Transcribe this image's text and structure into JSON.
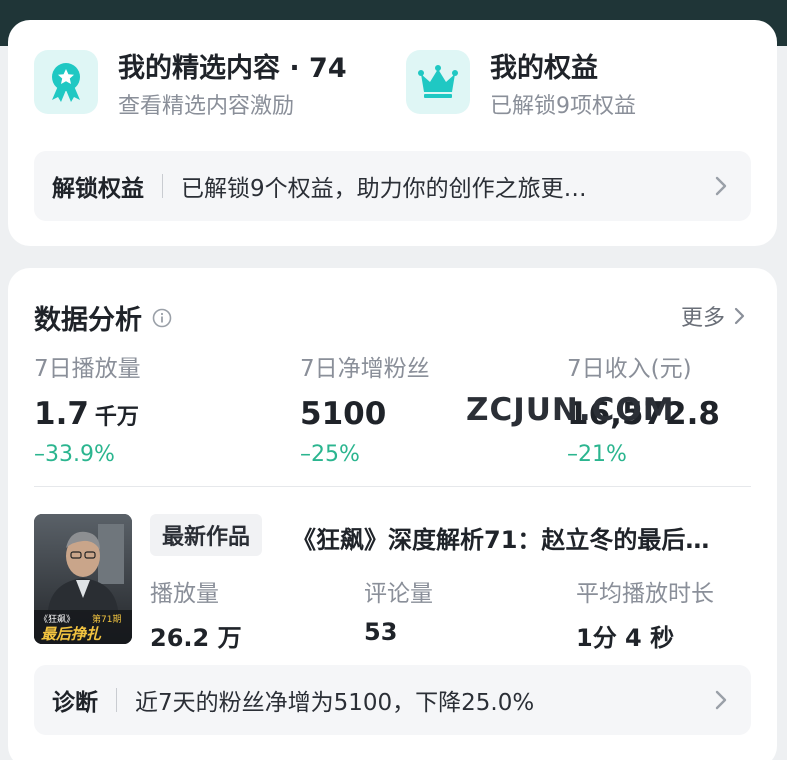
{
  "benefits_card": {
    "featured": {
      "title": "我的精选内容 · 74",
      "subtitle": "查看精选内容激励",
      "icon": "award-ribbon-icon"
    },
    "rights": {
      "title": "我的权益",
      "subtitle": "已解锁9项权益",
      "icon": "crown-icon"
    },
    "unlock": {
      "label": "解锁权益",
      "text": "已解锁9个权益，助力你的创作之旅更…"
    }
  },
  "analytics": {
    "title": "数据分析",
    "more_label": "更多",
    "metrics": [
      {
        "label": "7日播放量",
        "value": "1.7",
        "unit": "千万",
        "change": "–33.9%"
      },
      {
        "label": "7日净增粉丝",
        "value": "5100",
        "unit": "",
        "change": "–25%"
      },
      {
        "label": "7日收入(元)",
        "value": "16,572.8",
        "unit": "",
        "change": "–21%"
      }
    ],
    "overlay_mark": "ZCJUN.COM"
  },
  "latest_work": {
    "tag": "最新作品",
    "title": "《狂飙》深度解析71：赵立冬的最后…",
    "thumbnail": {
      "badge_show": "《狂飙》",
      "badge_episode": "第71期",
      "caption": "最后挣扎"
    },
    "stats": [
      {
        "label": "播放量",
        "value": "26.2 万"
      },
      {
        "label": "评论量",
        "value": "53"
      },
      {
        "label": "平均播放时长",
        "value": "1分 4 秒"
      }
    ]
  },
  "diagnosis": {
    "label": "诊断",
    "text": "近7天的粉丝净增为5100，下降25.0%"
  },
  "colors": {
    "accent_teal": "#1fc8c3",
    "decline_green": "#2bb58f",
    "topbar": "#1f3537"
  }
}
